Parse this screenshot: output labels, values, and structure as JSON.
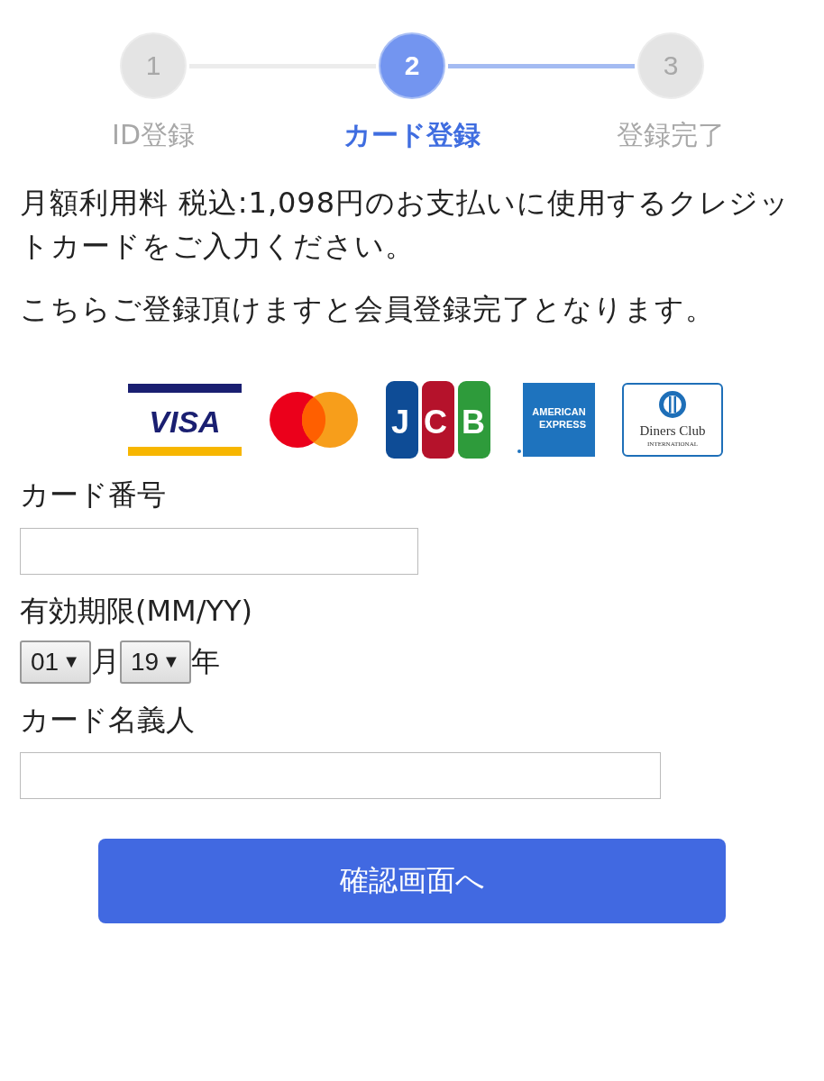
{
  "steps": [
    {
      "number": "1",
      "label": "ID登録",
      "selected": false
    },
    {
      "number": "2",
      "label": "カード登録",
      "selected": true
    },
    {
      "number": "3",
      "label": "登録完了",
      "selected": false
    }
  ],
  "intro": [
    "月額利用料 税込:1,098円のお支払いに使用するクレジットカードをご入力ください。",
    "こちらご登録頂けますと会員登録完了となります。"
  ],
  "card_brands": [
    {
      "kind": "visa",
      "text": "VISA"
    },
    {
      "kind": "mastercard"
    },
    {
      "kind": "jcb",
      "text": "JCB"
    },
    {
      "kind": "amex",
      "text": "AMERICAN",
      "subtext": "EXPRESS"
    },
    {
      "kind": "diners",
      "text": "Diners Club",
      "subtext": "INTERNATIONAL"
    }
  ],
  "card_number": {
    "label": "カード番号"
  },
  "expiry": {
    "label": "有効期限(MM/YY)",
    "month": {
      "value": "01",
      "arrow": "▼",
      "unit": "月"
    },
    "year": {
      "value": "19",
      "arrow": "▼",
      "unit": "年"
    }
  },
  "card_holder": {
    "label": "カード名義人"
  },
  "submit": "確認画面へ"
}
